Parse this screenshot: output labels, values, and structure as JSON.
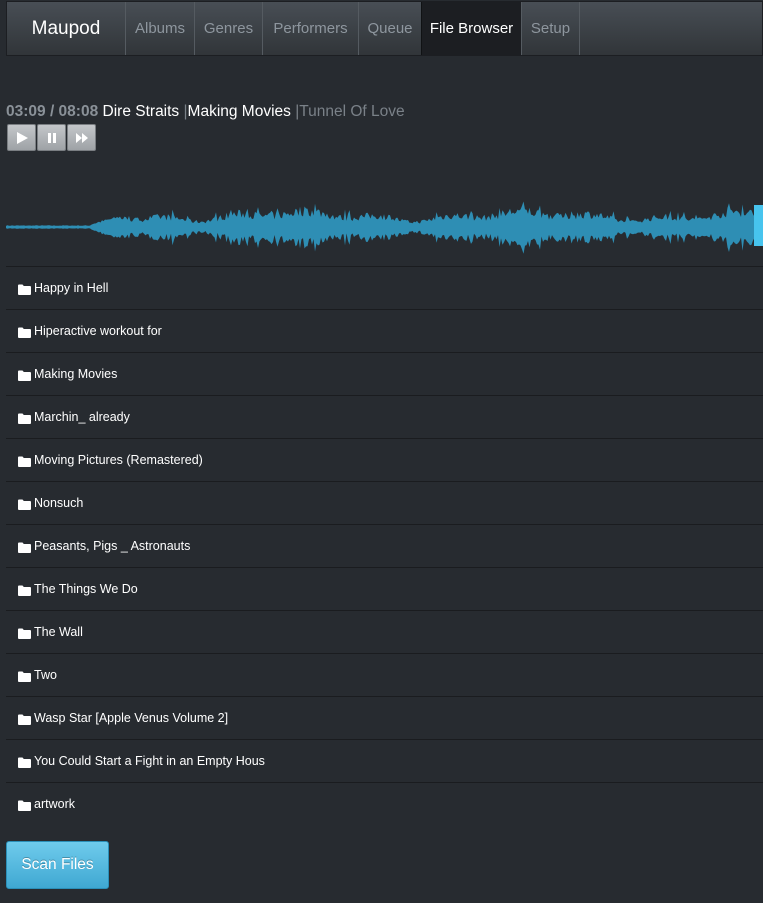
{
  "nav": {
    "brand": "Maupod",
    "tabs": [
      {
        "label": "Albums",
        "active": false
      },
      {
        "label": "Genres",
        "active": false
      },
      {
        "label": "Performers",
        "active": false
      },
      {
        "label": "Queue",
        "active": false
      },
      {
        "label": "File Browser",
        "active": true
      },
      {
        "label": "Setup",
        "active": false
      }
    ]
  },
  "player": {
    "time": "03:09 / 08:08",
    "artist": "Dire Straits",
    "separator": "|",
    "album": "Making Movies",
    "track": "Tunnel Of Love",
    "controls": [
      "play-icon",
      "pause-icon",
      "next-icon"
    ],
    "progress_fraction": 0.387,
    "colors": {
      "waveform": "#2e8eb4",
      "waveform_played": "#47c4ee"
    }
  },
  "files": [
    "Happy in Hell",
    "Hiperactive workout for",
    "Making Movies",
    "Marchin_ already",
    "Moving Pictures (Remastered)",
    "Nonsuch",
    "Peasants, Pigs _ Astronauts",
    "The Things We Do",
    "The Wall",
    "Two",
    "Wasp Star [Apple Venus Volume 2]",
    "You Could Start a Fight in an Empty Hous",
    "artwork"
  ],
  "actions": {
    "scan_label": "Scan Files"
  }
}
